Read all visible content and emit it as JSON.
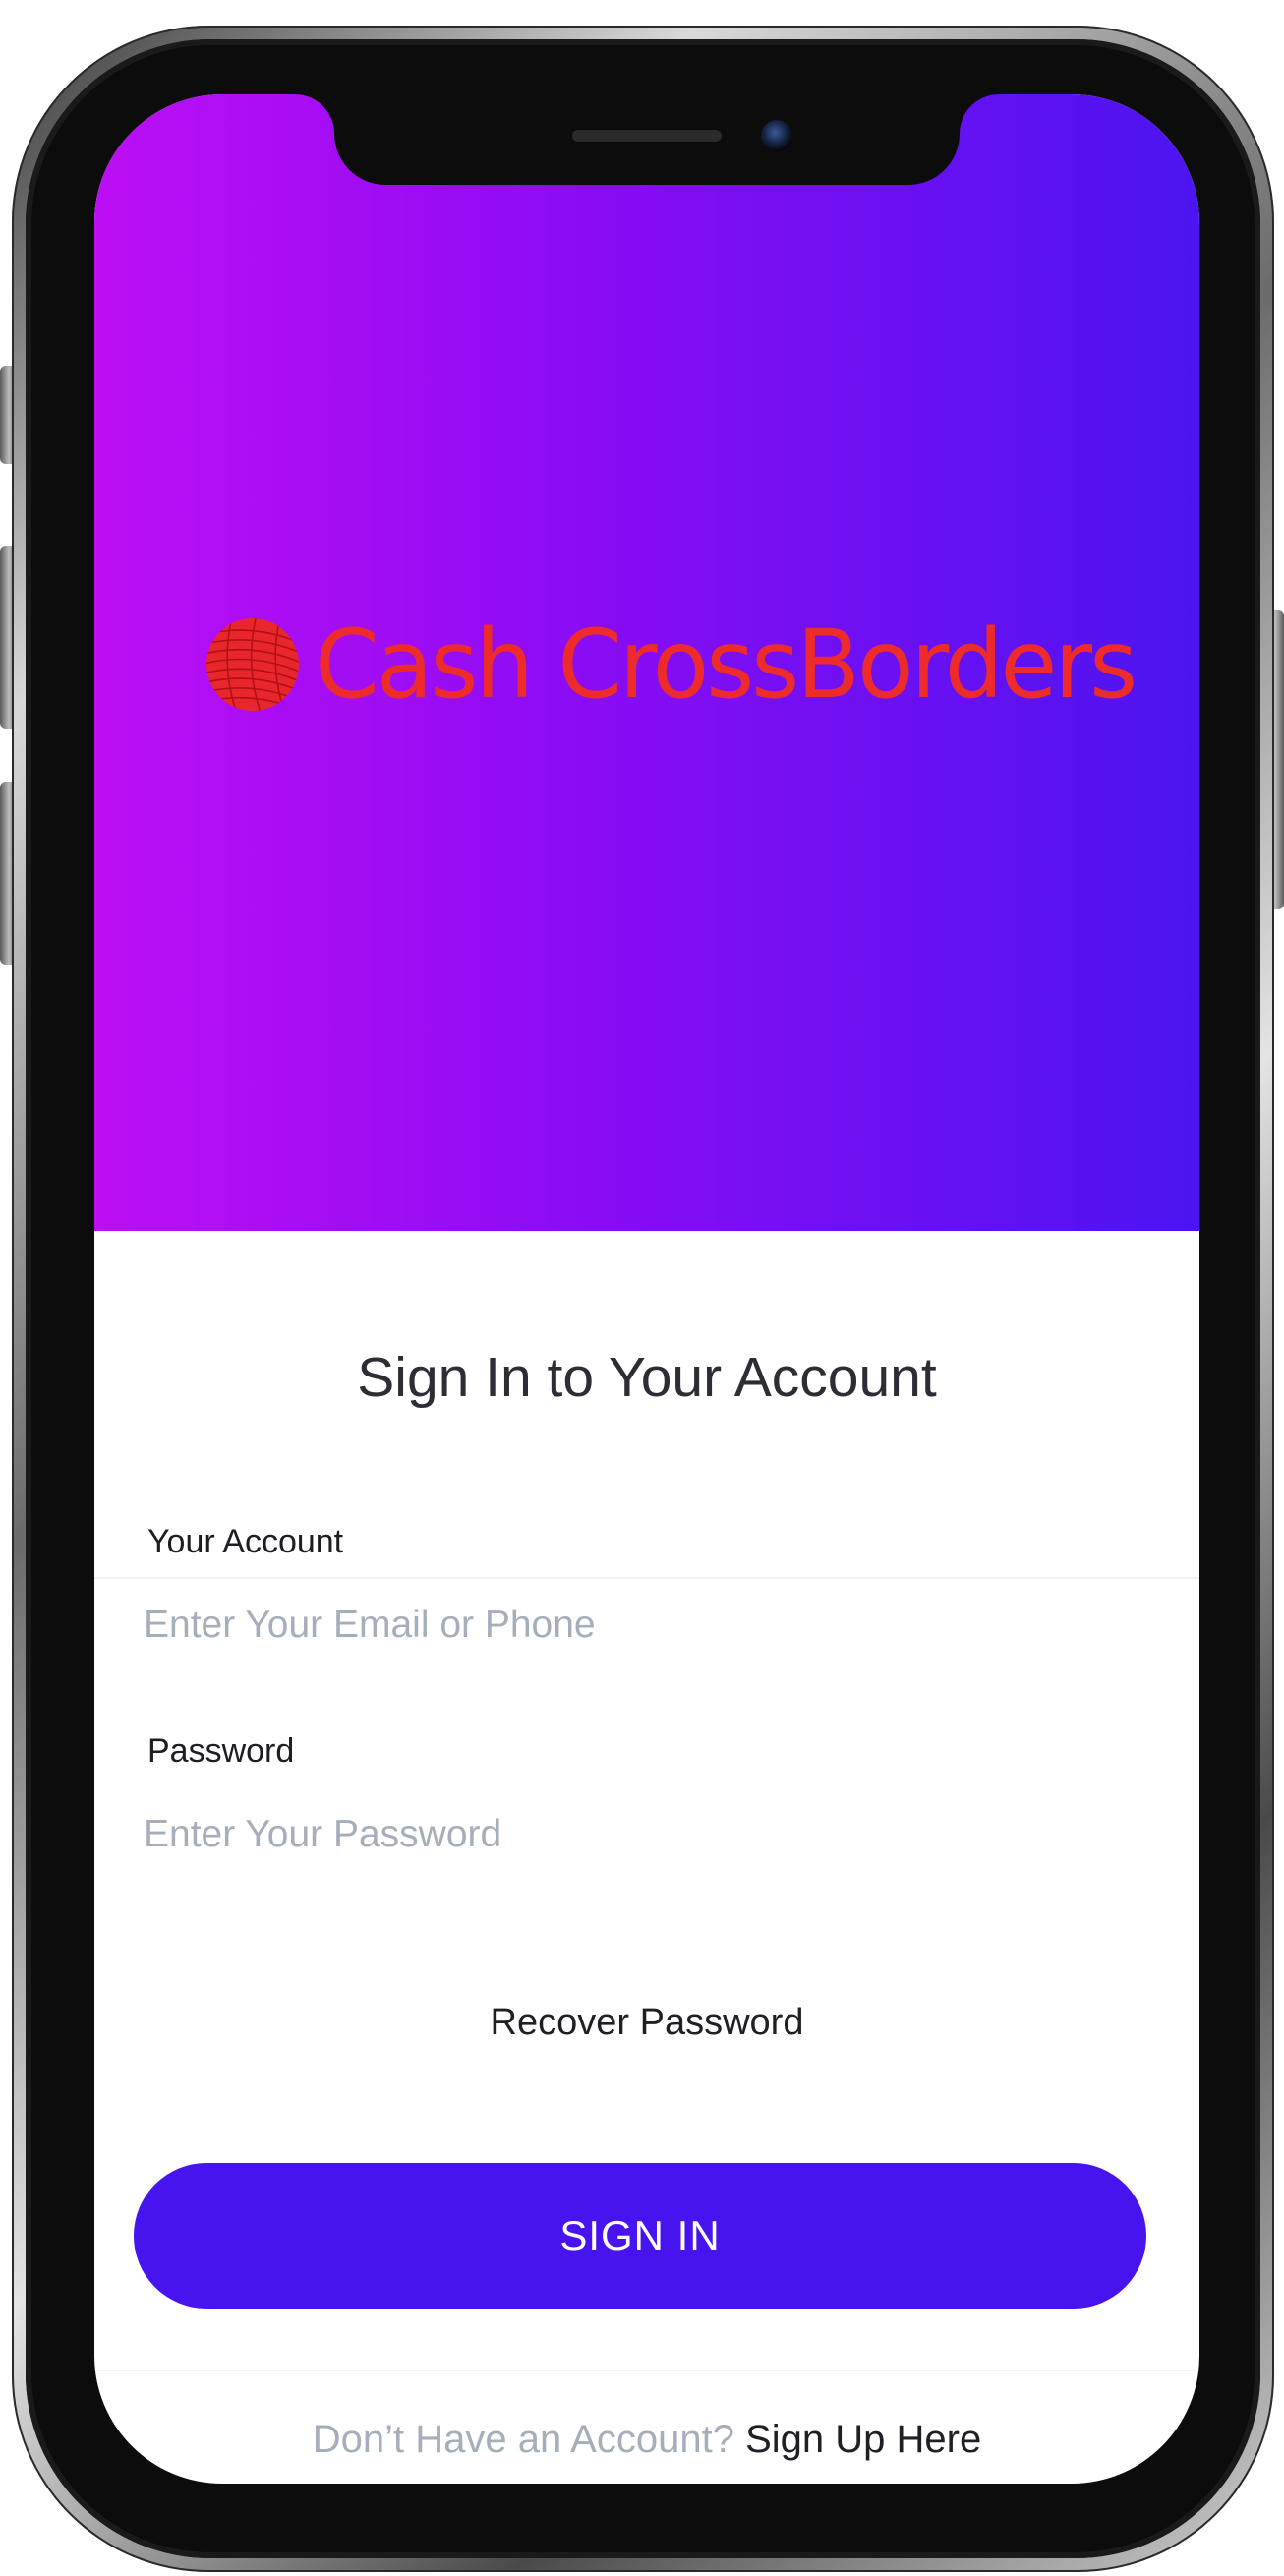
{
  "brand": {
    "name": "Cash CrossBorders",
    "logo_color": "#ee2b2b",
    "gradient": [
      "#bd0ef5",
      "#8a0cf4",
      "#4c14f2"
    ]
  },
  "signin": {
    "title": "Sign In to Your Account",
    "account_label": "Your Account",
    "account_placeholder": "Enter Your Email or Phone",
    "account_value": "",
    "password_label": "Password",
    "password_placeholder": "Enter Your Password",
    "password_value": "",
    "recover_label": "Recover Password",
    "button_label": "SIGN IN",
    "button_color": "#4714ef"
  },
  "footer": {
    "prompt": "Don’t Have an Account?",
    "link": "Sign Up Here"
  }
}
